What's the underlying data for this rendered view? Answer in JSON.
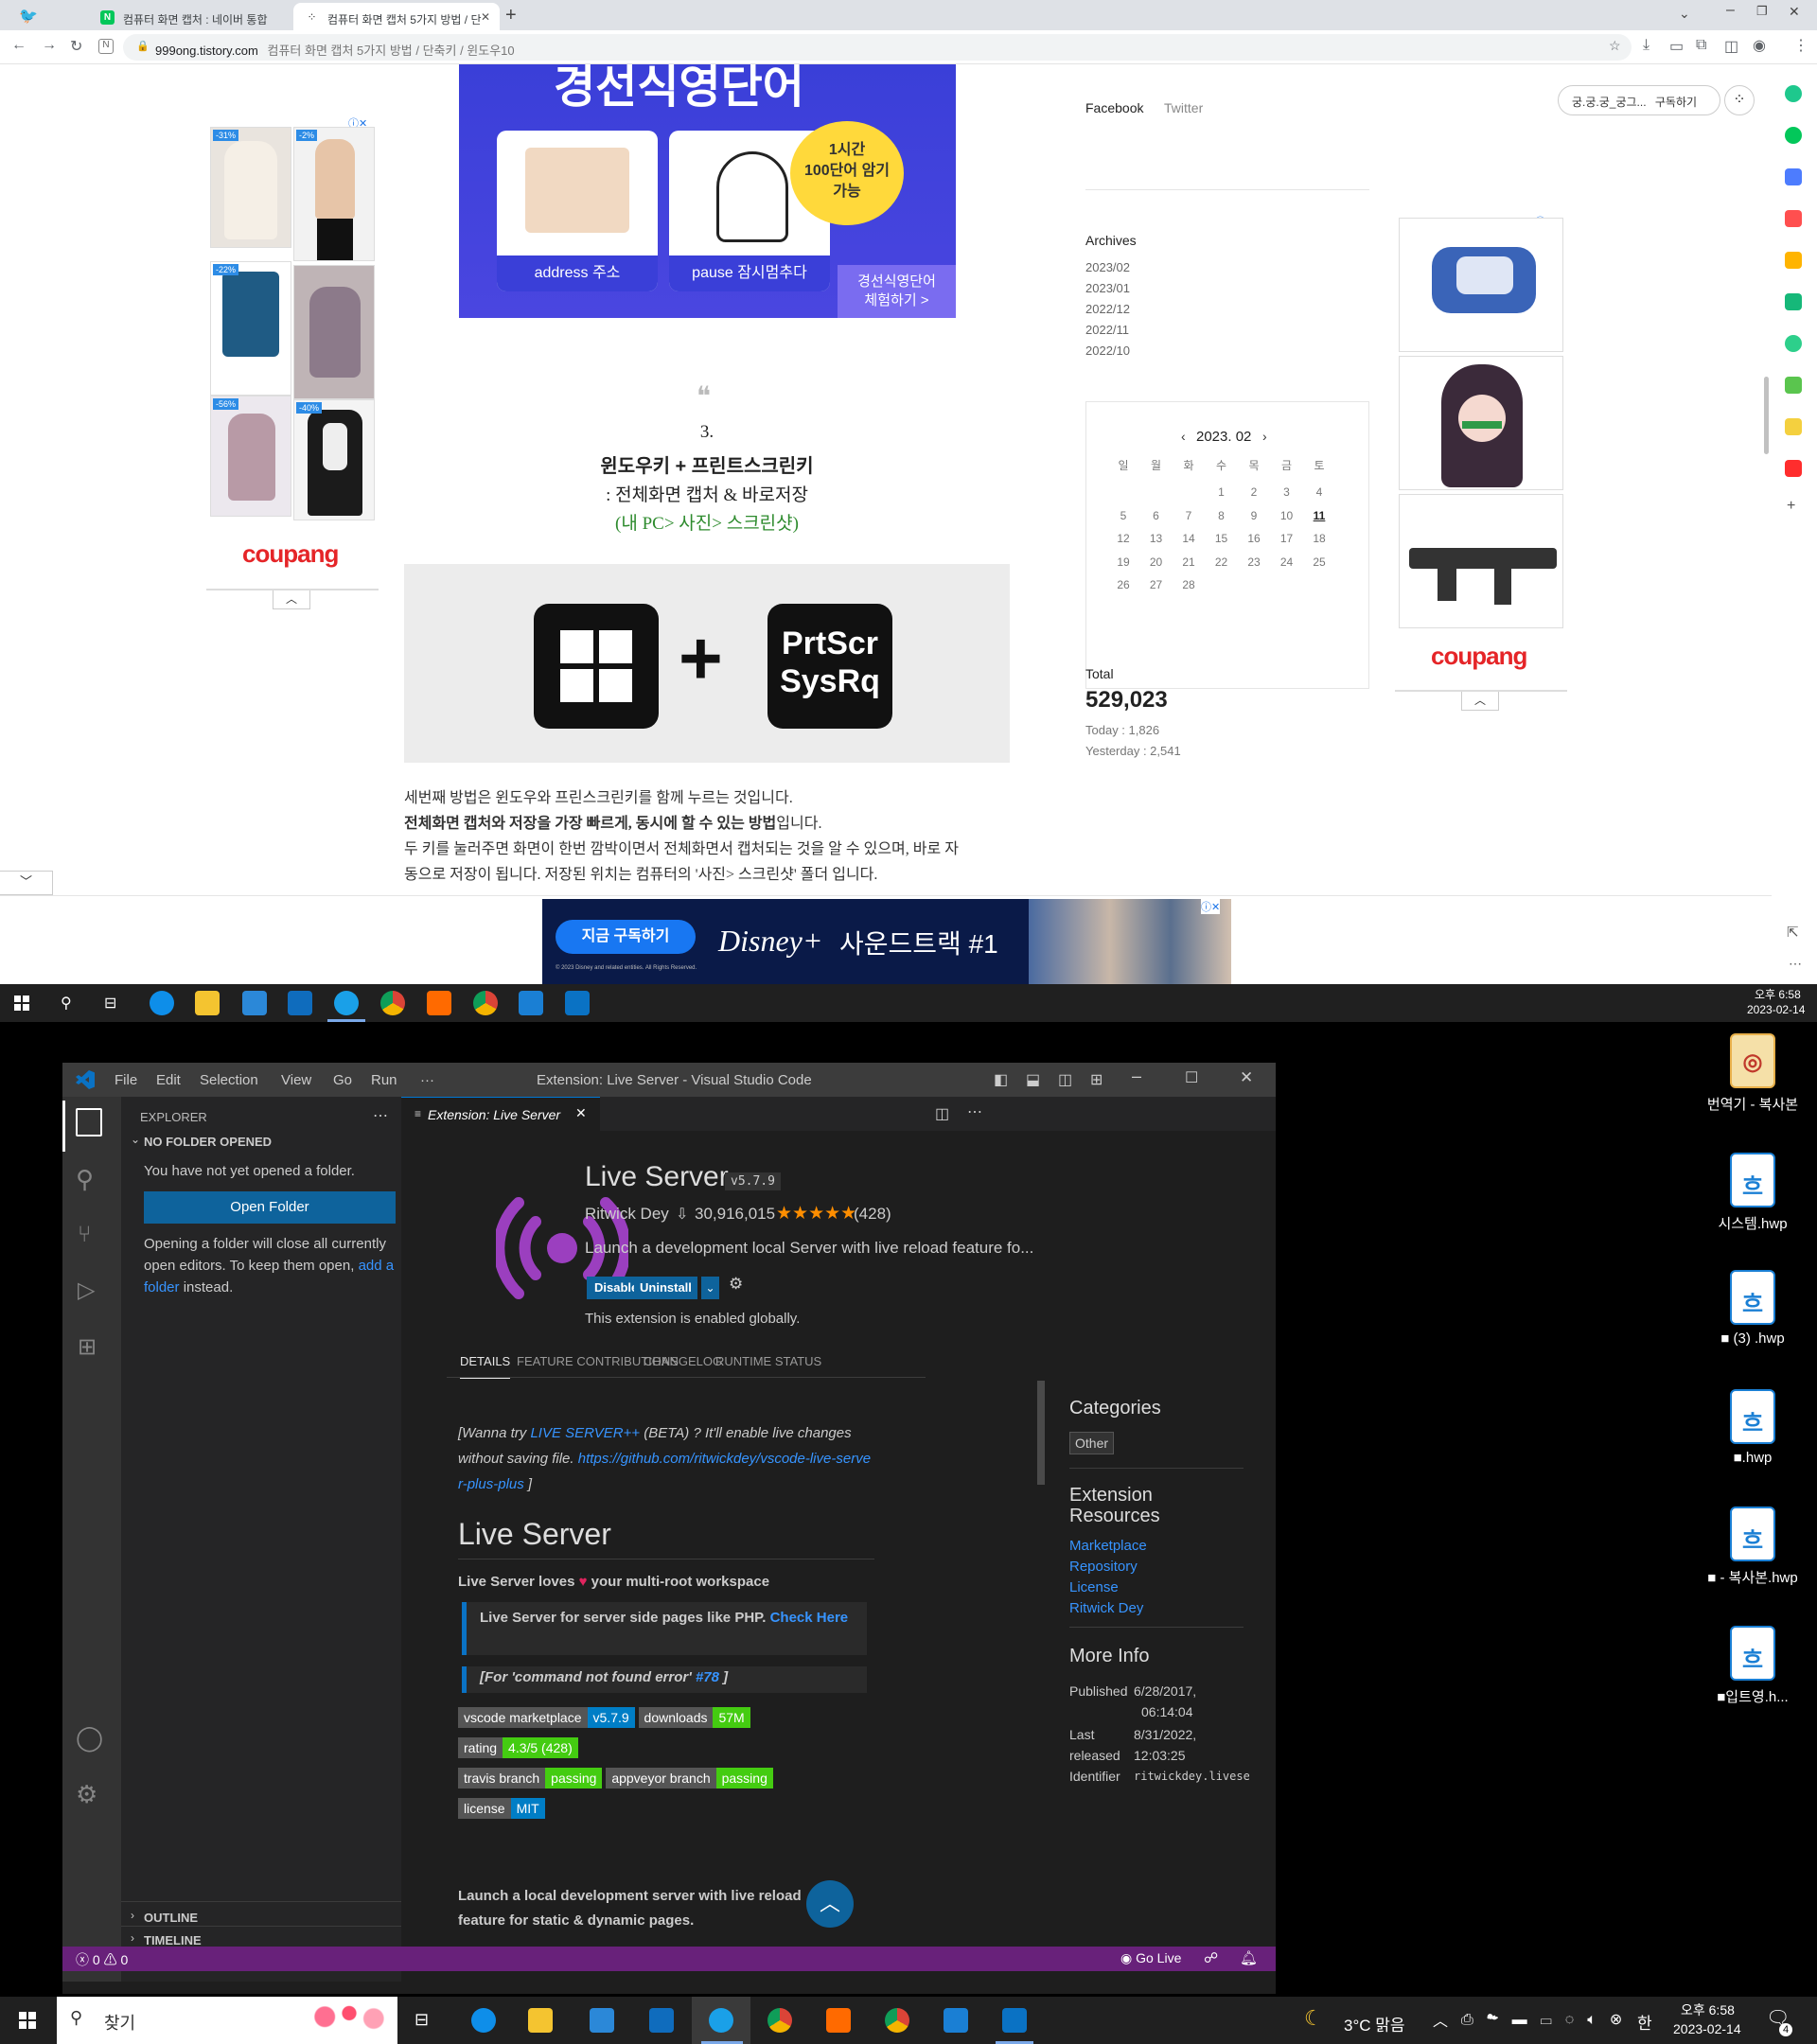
{
  "browser": {
    "tabs": [
      {
        "label": "컴퓨터 화면 캡처 : 네이버 통합"
      },
      {
        "label": "컴퓨터 화면 캡처 5가지 방법 / 단"
      }
    ],
    "url_domain": "999ong.tistory.com",
    "url_title": "컴퓨터 화면 캡처 5가지 방법 / 단축키 / 윈도우10"
  },
  "blog": {
    "subscribe_name": "궁.궁.궁_궁그...",
    "subscribe_label": "구독하기",
    "social": [
      "Facebook",
      "Twitter"
    ],
    "archives_title": "Archives",
    "archives": [
      "2023/02",
      "2023/01",
      "2022/12",
      "2022/11",
      "2022/10"
    ],
    "calendar": {
      "month": "2023. 02",
      "weekdays": [
        "일",
        "월",
        "화",
        "수",
        "목",
        "금",
        "토"
      ],
      "weeks": [
        [
          "",
          "",
          "",
          "1",
          "2",
          "3",
          "4"
        ],
        [
          "5",
          "6",
          "7",
          "8",
          "9",
          "10",
          "11"
        ],
        [
          "12",
          "13",
          "14",
          "15",
          "16",
          "17",
          "18"
        ],
        [
          "19",
          "20",
          "21",
          "22",
          "23",
          "24",
          "25"
        ],
        [
          "26",
          "27",
          "28",
          "",
          "",
          "",
          ""
        ]
      ],
      "today": "11"
    },
    "total_label": "Total",
    "total_value": "529,023",
    "today_label": "Today : 1,826",
    "yesterday_label": "Yesterday : 2,541"
  },
  "ad_top": {
    "banner_title": "경선식영단어",
    "bubble": "1시간\n100단어 암기\n가능",
    "card1_label": "address 주소",
    "card2_label": "pause 잠시멈추다",
    "cta": "경선식영단어\n체험하기 >"
  },
  "coupang": {
    "logo": "coupang",
    "left_badges": [
      "-31%",
      "-2%",
      "-22%",
      "",
      "-56%",
      "-40%"
    ]
  },
  "article": {
    "quote_mark": "❝",
    "num": "3.",
    "heading": "윈도우키 + 프린트스크린키",
    "sub": ": 전체화면 캡처 & 바로저장",
    "path": "(내 PC> 사진> 스크린샷)",
    "key_label_1": "PrtScr",
    "key_label_2": "SysRq",
    "plus": "+",
    "p1": "세번째 방법은 윈도우와 프린스크린키를 함께 누르는 것입니다.",
    "p2_bold": "전체화면 캡처와 저장을 가장 빠르게, 동시에 할 수 있는 방법",
    "p2_rest": "입니다.",
    "p3": "두 키를 눌러주면 화면이 한번 깜박이면서 전체화면서 캡처되는 것을 알 수 있으며, 바로 자",
    "p4": "동으로 저장이 됩니다. 저장된 위치는 컴퓨터의 '사진> 스크린샷' 폴더 입니다."
  },
  "ad_bottom": {
    "cta": "지금 구독하기",
    "brand": "Disney+",
    "headline": "사운드트랙 #1",
    "fine": "© 2023 Disney and related entities. All Rights Reserved."
  },
  "taskbar_top": {
    "time": "오후 6:58",
    "date": "2023-02-14"
  },
  "vscode": {
    "window_title": "Extension: Live Server - Visual Studio Code",
    "menu": [
      "File",
      "Edit",
      "Selection",
      "View",
      "Go",
      "Run",
      "···"
    ],
    "explorer_title": "EXPLORER",
    "no_folder": "NO FOLDER OPENED",
    "not_opened": "You have not yet opened a folder.",
    "open_folder": "Open Folder",
    "opening_text_1": "Opening a folder will close all currently open editors. To keep them open,",
    "opening_link": "add a folder",
    "opening_text_2": "instead.",
    "outline": "OUTLINE",
    "timeline": "TIMELINE",
    "tab_label": "Extension: Live Server",
    "ext": {
      "name": "Live Server",
      "version": "v5.7.9",
      "author": "Ritwick Dey",
      "installs": "30,916,015",
      "stars": "★★★★★",
      "rating_count": "(428)",
      "description": "Launch a development local Server with live reload feature fo...",
      "disable": "Disable",
      "uninstall": "Uninstall",
      "enabled_text": "This extension is enabled globally.",
      "tabs": [
        "DETAILS",
        "FEATURE CONTRIBUTIONS",
        "CHANGELOG",
        "RUNTIME STATUS"
      ]
    },
    "readme": {
      "try_1": "[Wanna try",
      "try_link": "LIVE SERVER++",
      "try_2": "(BETA) ? It'll enable live changes without saving file.",
      "try_url": "https://github.com/ritwickdey/vscode-live-server-plus-plus",
      "try_end": "]",
      "h1": "Live Server",
      "loves_1": "Live Server loves",
      "loves_2": "your multi-root workspace",
      "bq1": "Live Server for server side pages like PHP.",
      "bq1_link": "Check Here",
      "bq2_1": "[For 'command not found error'",
      "bq2_link": "#78",
      "bq2_2": "]",
      "badges": [
        {
          "l": "vscode marketplace",
          "r": "v5.7.9",
          "c": "#007ec6"
        },
        {
          "l": "downloads",
          "r": "57M",
          "c": "#4c1"
        },
        {
          "l": "rating",
          "r": "4.3/5 (428)",
          "c": "#4c1"
        },
        {
          "l": "travis branch",
          "r": "passing",
          "c": "#4c1"
        },
        {
          "l": "appveyor branch",
          "r": "passing",
          "c": "#4c1"
        },
        {
          "l": "license",
          "r": "MIT",
          "c": "#007ec6"
        }
      ],
      "launch": "Launch a local development server with live reload feature for static & dynamic pages."
    },
    "aside": {
      "categories": "Categories",
      "cat_other": "Other",
      "resources": "Extension Resources",
      "links": [
        "Marketplace",
        "Repository",
        "License",
        "Ritwick Dey"
      ],
      "more_info": "More Info",
      "published_label": "Published",
      "published_value_1": "6/28/2017,",
      "published_value_2": "06:14:04",
      "last_label_1": "Last",
      "last_label_2": "released",
      "last_value_1": "8/31/2022,",
      "last_value_2": "12:03:25",
      "identifier_label": "Identifier",
      "identifier_value": "ritwickdey.liveser"
    },
    "status": {
      "errors": "0",
      "warnings": "0",
      "golive": "Go Live"
    }
  },
  "desktop_icons": [
    "번역기 - 복사본",
    "시스템.hwp",
    "■ (3) .hwp",
    "■.hwp",
    "■ - 복사본.hwp",
    "■입트영.h..."
  ],
  "taskbar_bottom": {
    "search": "찾기",
    "weather": "3°C 맑음",
    "ime": "한",
    "time": "오후 6:58",
    "date": "2023-02-14",
    "notif": "4"
  },
  "colors": {
    "vscode_status": "#68217a",
    "vscode_accent": "#0e639c",
    "coupang_red": "#e52528"
  }
}
